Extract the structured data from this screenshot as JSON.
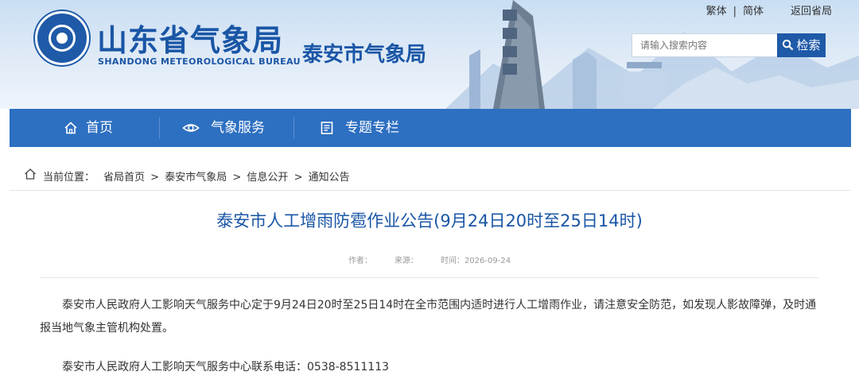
{
  "header": {
    "logo_title": "山东省气象局",
    "logo_subtitle": "SHANDONG METEOROLOGICAL BUREAU",
    "city_title": "泰安市气象局",
    "top_links": [
      "繁体",
      "简体",
      "返回省局"
    ],
    "search": {
      "placeholder": "请输入搜索内容",
      "button_label": "检索"
    },
    "brand_color": "#1a56a6"
  },
  "nav": {
    "items": [
      {
        "label": "首页",
        "icon": "home-icon"
      },
      {
        "label": "气象服务",
        "icon": "eye-icon"
      },
      {
        "label": "专题专栏",
        "icon": "document-icon"
      }
    ],
    "bg_color": "#2d6fc1"
  },
  "breadcrumb": {
    "prefix": "当前位置：",
    "items": [
      "省局首页",
      "泰安市气象局",
      "信息公开",
      "通知公告"
    ],
    "separator": ">"
  },
  "article": {
    "title": "泰安市人工增雨防雹作业公告(9月24日20时至25日14时)",
    "meta": {
      "author_label": "作者：",
      "source_label": "来源：",
      "time_label": "时间：",
      "time_value": "2026-09-24"
    },
    "paragraphs": [
      "泰安市人民政府人工影响天气服务中心定于9月24日20时至25日14时在全市范围内适时进行人工增雨作业，请注意安全防范，如发现人影故障弹，及时通报当地气象主管机构处置。",
      "泰安市人民政府人工影响天气服务中心联系电话：0538-8511113"
    ]
  }
}
